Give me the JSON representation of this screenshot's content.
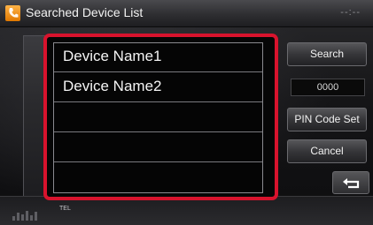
{
  "header": {
    "title": "Searched Device List",
    "clock": "--:--",
    "app_icon": "phone-handset-icon"
  },
  "device_list": {
    "items": [
      {
        "label": "Device Name1"
      },
      {
        "label": "Device Name2"
      },
      {
        "label": ""
      },
      {
        "label": ""
      },
      {
        "label": ""
      }
    ]
  },
  "buttons": {
    "search": "Search",
    "pin_code_set": "PIN Code Set",
    "cancel": "Cancel",
    "back_icon": "return-arrow-icon"
  },
  "pin_code": {
    "value": "0000"
  },
  "status_bar": {
    "source": "TEL",
    "level_icon": "signal-bars-icon"
  },
  "colors": {
    "highlight": "#d8132d",
    "app_icon": "#f08a00"
  }
}
